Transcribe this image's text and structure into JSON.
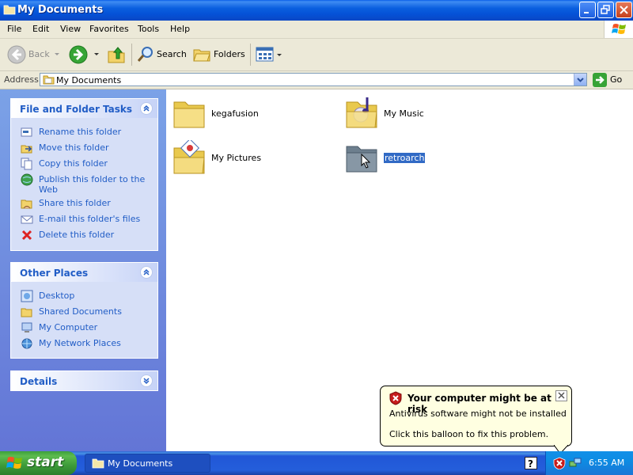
{
  "window": {
    "title": "My Documents"
  },
  "menu": {
    "items": [
      "File",
      "Edit",
      "View",
      "Favorites",
      "Tools",
      "Help"
    ]
  },
  "toolbar": {
    "back_label": "Back",
    "search_label": "Search",
    "folders_label": "Folders"
  },
  "address": {
    "label": "Address",
    "value": "My Documents",
    "go_label": "Go"
  },
  "tasks": {
    "title": "File and Folder Tasks",
    "items": [
      {
        "label": "Rename this folder",
        "icon": "rename-icon"
      },
      {
        "label": "Move this folder",
        "icon": "move-icon"
      },
      {
        "label": "Copy this folder",
        "icon": "copy-icon"
      },
      {
        "label": "Publish this folder to the Web",
        "icon": "globe-icon"
      },
      {
        "label": "Share this folder",
        "icon": "share-icon"
      },
      {
        "label": "E-mail this folder's files",
        "icon": "email-icon"
      },
      {
        "label": "Delete this folder",
        "icon": "delete-icon"
      }
    ]
  },
  "places": {
    "title": "Other Places",
    "items": [
      {
        "label": "Desktop",
        "icon": "desktop-icon"
      },
      {
        "label": "Shared Documents",
        "icon": "folder-icon"
      },
      {
        "label": "My Computer",
        "icon": "computer-icon"
      },
      {
        "label": "My Network Places",
        "icon": "network-icon"
      }
    ]
  },
  "details": {
    "title": "Details"
  },
  "files": [
    {
      "name": "kegafusion",
      "icon": "folder-icon"
    },
    {
      "name": "My Music",
      "icon": "music-folder-icon"
    },
    {
      "name": "My Pictures",
      "icon": "pictures-folder-icon"
    },
    {
      "name": "retroarch",
      "icon": "folder-icon",
      "selected": true
    }
  ],
  "balloon": {
    "title": "Your computer might be at risk",
    "line1": "Antivirus software might not be installed",
    "line2": "Click this balloon to fix this problem."
  },
  "taskbar": {
    "start_label": "start",
    "task_label": "My Documents",
    "clock": "6:55 AM"
  },
  "colors": {
    "link": "#215dc6",
    "selection": "#316ac5",
    "balloon": "#ffffe1"
  }
}
